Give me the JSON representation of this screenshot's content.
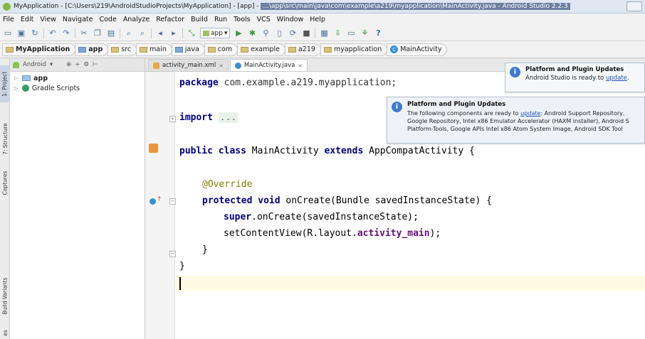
{
  "window": {
    "title_start": "MyApplication - [C:\\Users\\219\\AndroidStudioProjects\\MyApplication] - [app] - ",
    "title_mid": "...\\app\\src\\main\\java\\com\\example\\a219\\myapplication\\MainActivity.java - Android Studio 2.2.3"
  },
  "menu": [
    "File",
    "Edit",
    "View",
    "Navigate",
    "Code",
    "Analyze",
    "Refactor",
    "Build",
    "Run",
    "Tools",
    "VCS",
    "Window",
    "Help"
  ],
  "toolbar": {
    "run_config": "app",
    "help": "?"
  },
  "breadcrumbs": [
    "MyApplication",
    "app",
    "src",
    "main",
    "java",
    "com",
    "example",
    "a219",
    "myapplication",
    "MainActivity"
  ],
  "left_strip": {
    "project": "1: Project",
    "structure": "7: Structure",
    "captures": "Captures",
    "build_variants": "Build Variants",
    "favorites": "es"
  },
  "project_panel": {
    "view_mode": "Android",
    "tree": [
      {
        "label": "app",
        "kind": "folder"
      },
      {
        "label": "Gradle Scripts",
        "kind": "gradle"
      }
    ]
  },
  "editor": {
    "tabs": [
      {
        "label": "activity_main.xml",
        "active": false
      },
      {
        "label": "MainActivity.java",
        "active": true
      }
    ],
    "code": {
      "package_kw": "package",
      "package_name": " com.example.a219.myapplication;",
      "import_kw": "import",
      "import_fold": "...",
      "class_line": {
        "mods": "public class",
        "name": " MainActivity ",
        "extends": "extends",
        "parent": " AppCompatActivity {"
      },
      "annotation": "@Override",
      "method_line": {
        "mods": "protected void",
        "rest": " onCreate(Bundle savedInstanceState) {"
      },
      "super_line": {
        "kw": "super",
        "rest": ".onCreate(savedInstanceState);"
      },
      "setcontent_line": {
        "start": "setContentView(R.layout.",
        "field": "activity_main",
        "end": ");"
      },
      "close_method": "}",
      "close_class": "}"
    }
  },
  "notifications": {
    "small": {
      "title": "Platform and Plugin Updates",
      "body_start": "Android Studio is ready to ",
      "link": "update",
      "body_end": "."
    },
    "big": {
      "title": "Platform and Plugin Updates",
      "line1_start": "The following components are ready to ",
      "line1_link": "update",
      "line1_end": ": Android Support Repository,",
      "line2": "Google Repository, Intel x86 Emulator Accelerator (HAXM installer), Android S",
      "line3": "Platform-Tools, Google APIs Intel x86 Atom System Image, Android SDK Tool"
    }
  }
}
